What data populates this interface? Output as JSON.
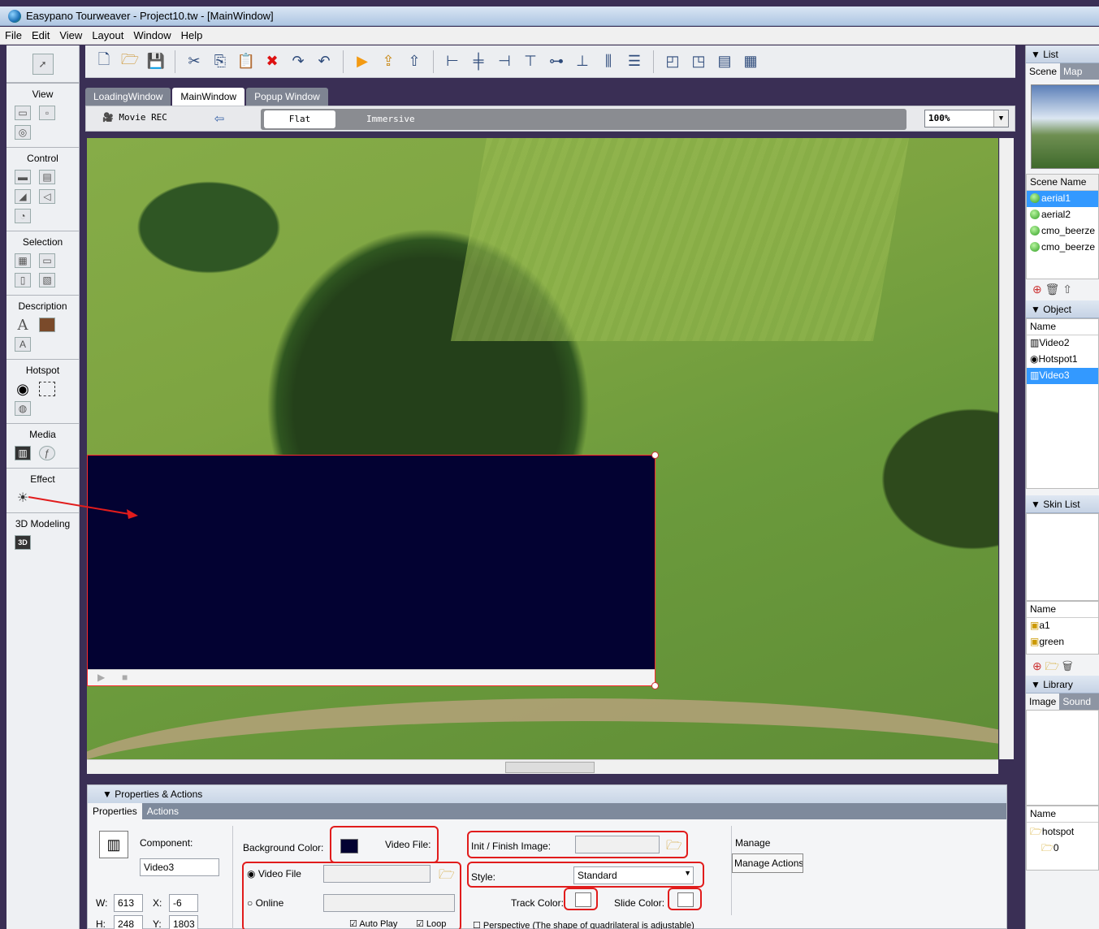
{
  "window": {
    "title": "Easypano Tourweaver - Project10.tw - [MainWindow]"
  },
  "menu": [
    "File",
    "Edit",
    "View",
    "Layout",
    "Window",
    "Help"
  ],
  "toolbox": {
    "sections": [
      "View",
      "Control",
      "Selection",
      "Description",
      "Hotspot",
      "Media",
      "Effect",
      "3D Modeling"
    ]
  },
  "window_tabs": [
    "LoadingWindow",
    "MainWindow",
    "Popup Window"
  ],
  "viewbar": {
    "movie_rec": "Movie REC",
    "flat": "Flat",
    "immersive": "Immersive",
    "zoom": "100%"
  },
  "properties": {
    "panel_title": "Properties & Actions",
    "tabs": [
      "Properties",
      "Actions"
    ],
    "component_label": "Component:",
    "component_value": "Video3",
    "w_label": "W:",
    "w_value": "613",
    "x_label": "X:",
    "x_value": "-6",
    "h_label": "H:",
    "h_value": "248",
    "y_label": "Y:",
    "y_value": "1803",
    "bg_color_label": "Background Color:",
    "video_file_header": "Video File:",
    "radio_video_file": "Video File",
    "radio_online": "Online",
    "auto_play": "Auto Play",
    "loop": "Loop",
    "init_finish_label": "Init / Finish Image:",
    "style_label": "Style:",
    "style_value": "Standard",
    "track_color_label": "Track Color:",
    "slide_color_label": "Slide Color:",
    "perspective": "Perspective (The shape of quadrilateral is adjustable)",
    "manage_label": "Manage",
    "manage_actions": "Manage Actions"
  },
  "dock": {
    "list_title": "List",
    "list_tabs": [
      "Scene",
      "Map"
    ],
    "scene_name_header": "Scene Name",
    "scenes": [
      "aerial1",
      "aerial2",
      "cmo_beerze",
      "cmo_beerze"
    ],
    "object_title": "Object",
    "object_name_header": "Name",
    "objects": [
      "Video2",
      "Hotspot1",
      "Video3"
    ],
    "skin_title": "Skin List",
    "skin_name_header": "Name",
    "skins": [
      "a1",
      "green"
    ],
    "library_title": "Library",
    "library_tabs": [
      "Image",
      "Sound"
    ],
    "library_name_header": "Name",
    "library_items": [
      "hotspot",
      "0"
    ]
  },
  "colors": {
    "video_bg": "#030232",
    "selection": "#3399ff",
    "highlight_box": "#e11c1c"
  }
}
